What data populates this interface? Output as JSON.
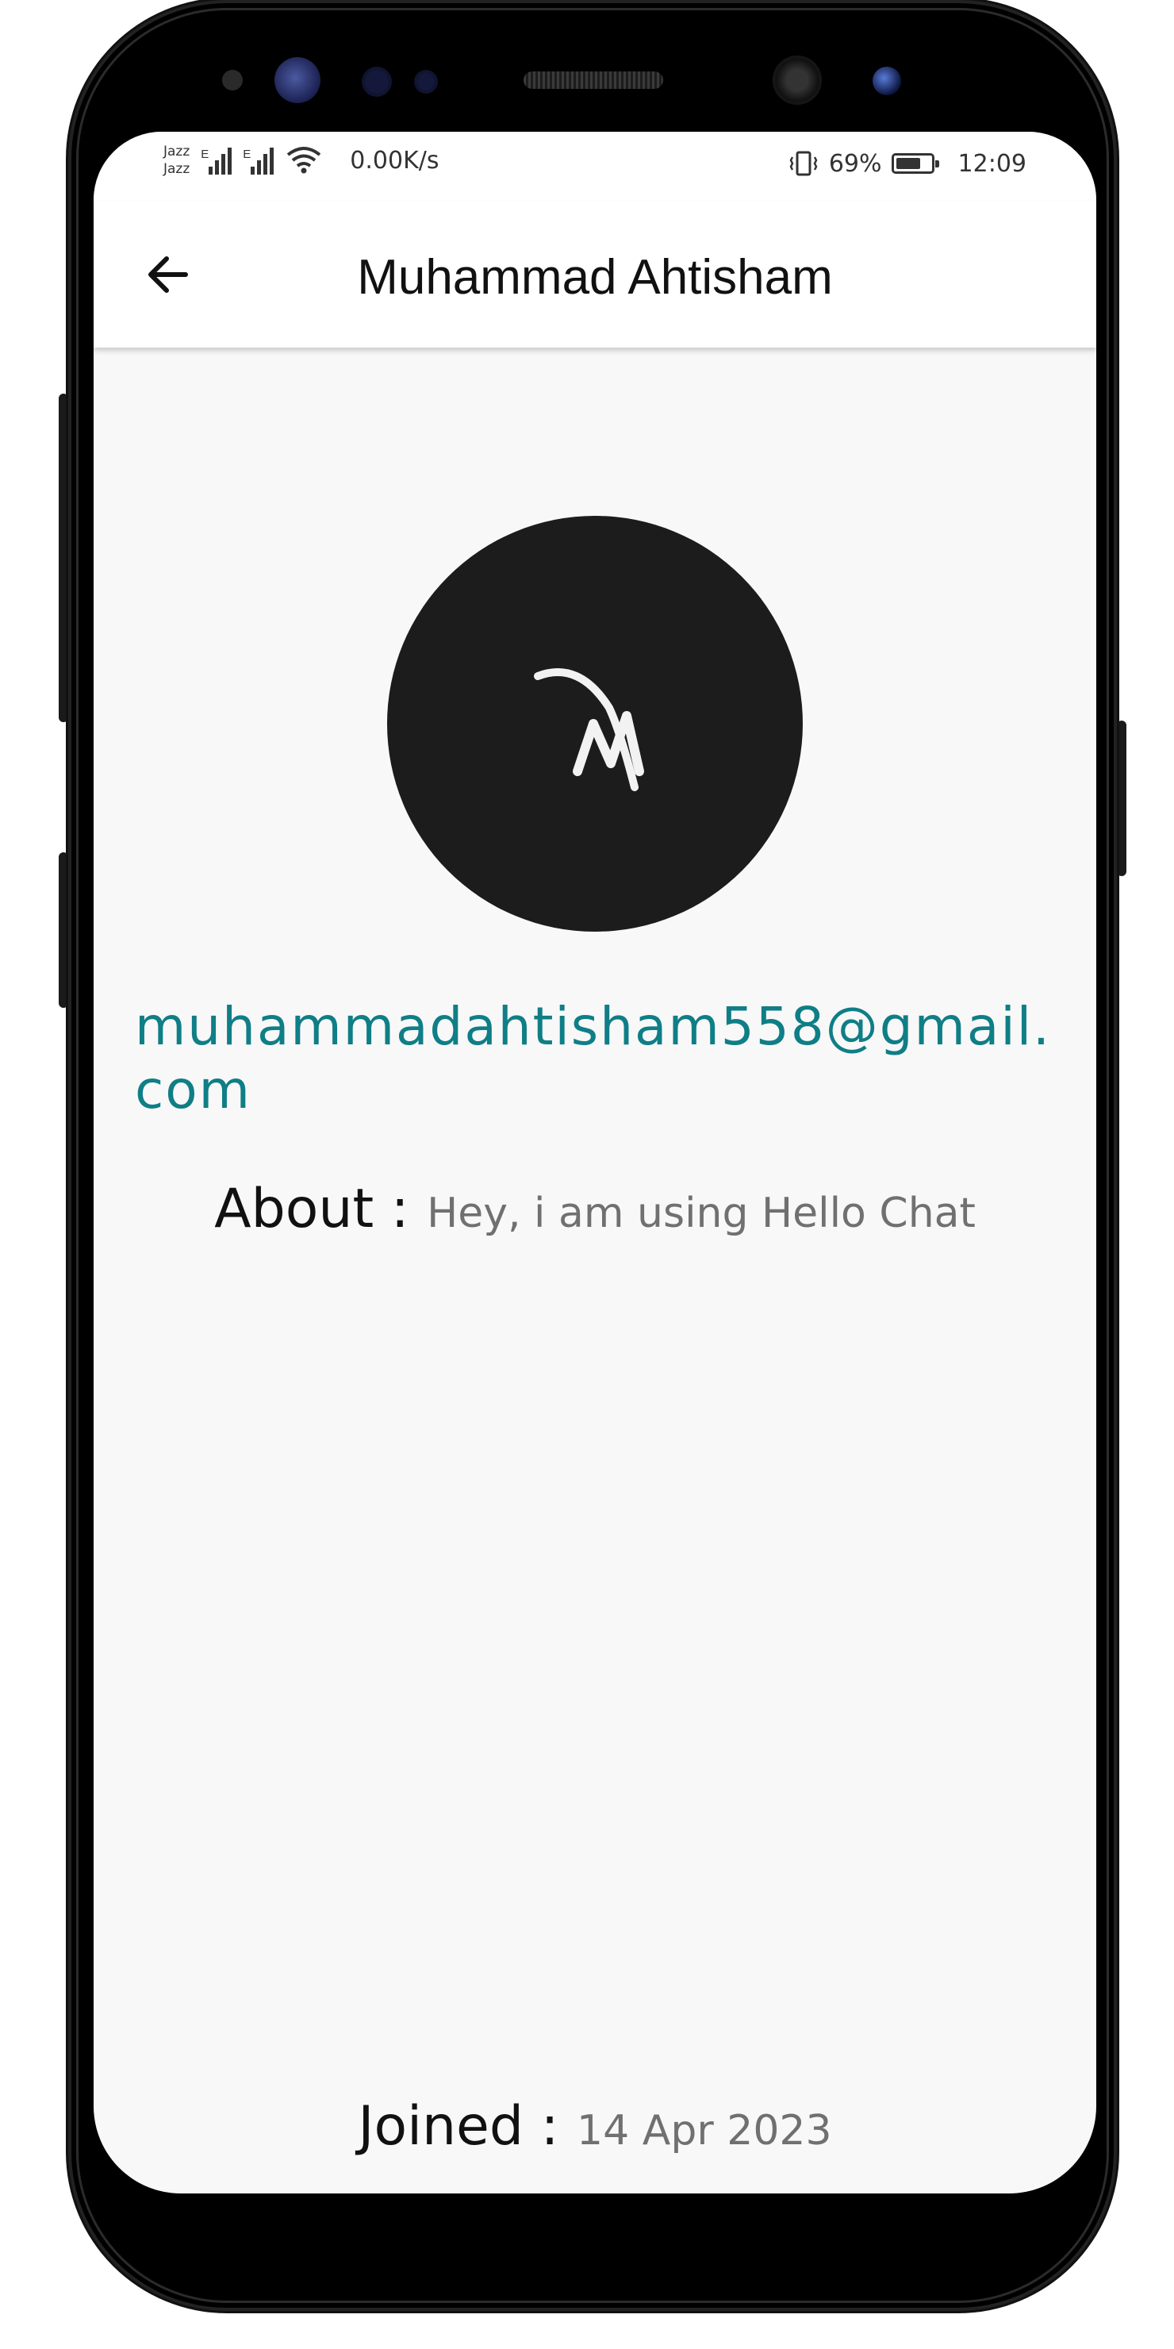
{
  "status_bar": {
    "carrier_1": "Jazz",
    "carrier_2": "Jazz",
    "net_type_1": "E",
    "net_type_2": "E",
    "net_speed": "0.00K/s",
    "battery_percent": "69%",
    "time": "12:09"
  },
  "appbar": {
    "title": "Muhammad Ahtisham",
    "back_icon": "arrow-left-icon"
  },
  "profile": {
    "avatar_initial": "M",
    "email": "muhammadahtisham558@gmail.com",
    "about_label": "About :",
    "about_value": "Hey, i am using Hello Chat",
    "joined_label": "Joined :",
    "joined_value": "14 Apr 2023"
  },
  "colors": {
    "email": "#0f7e86",
    "avatar_bg": "#1c1c1c",
    "screen_bg": "#f8f8f8"
  }
}
